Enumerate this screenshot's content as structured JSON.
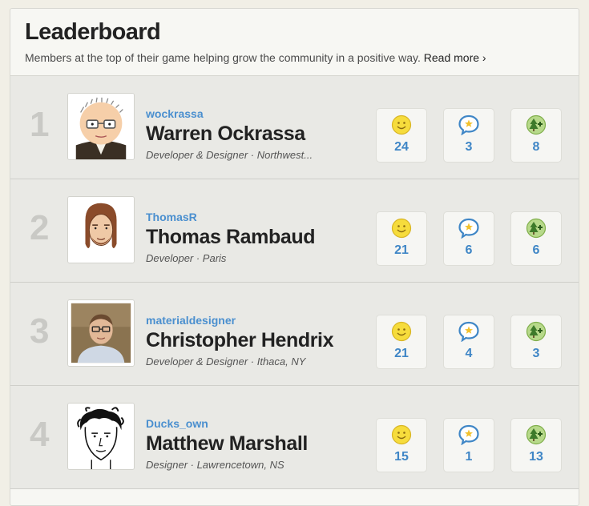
{
  "header": {
    "title": "Leaderboard",
    "subtitle": "Members at the top of their game helping grow the community in a positive way.",
    "read_more": "Read more ›"
  },
  "stat_icons": [
    "smiley-icon",
    "star-speech-bubble-icon",
    "tree-plus-icon"
  ],
  "colors": {
    "username": "#4a8fcf",
    "stat_number": "#3f86c6",
    "rank": "#c9c9c5",
    "row_bg": "#e9e9e5"
  },
  "members": [
    {
      "rank": "1",
      "username": "wockrassa",
      "name": "Warren Ockrassa",
      "meta": "Developer & Designer · Northwest...",
      "stats": [
        "24",
        "3",
        "8"
      ]
    },
    {
      "rank": "2",
      "username": "ThomasR",
      "name": "Thomas Rambaud",
      "meta": "Developer · Paris",
      "stats": [
        "21",
        "6",
        "6"
      ]
    },
    {
      "rank": "3",
      "username": "materialdesigner",
      "name": "Christopher Hendrix",
      "meta": "Developer & Designer · Ithaca, NY",
      "stats": [
        "21",
        "4",
        "3"
      ]
    },
    {
      "rank": "4",
      "username": "Ducks_own",
      "name": "Matthew Marshall",
      "meta": "Designer · Lawrencetown, NS",
      "stats": [
        "15",
        "1",
        "13"
      ]
    }
  ]
}
